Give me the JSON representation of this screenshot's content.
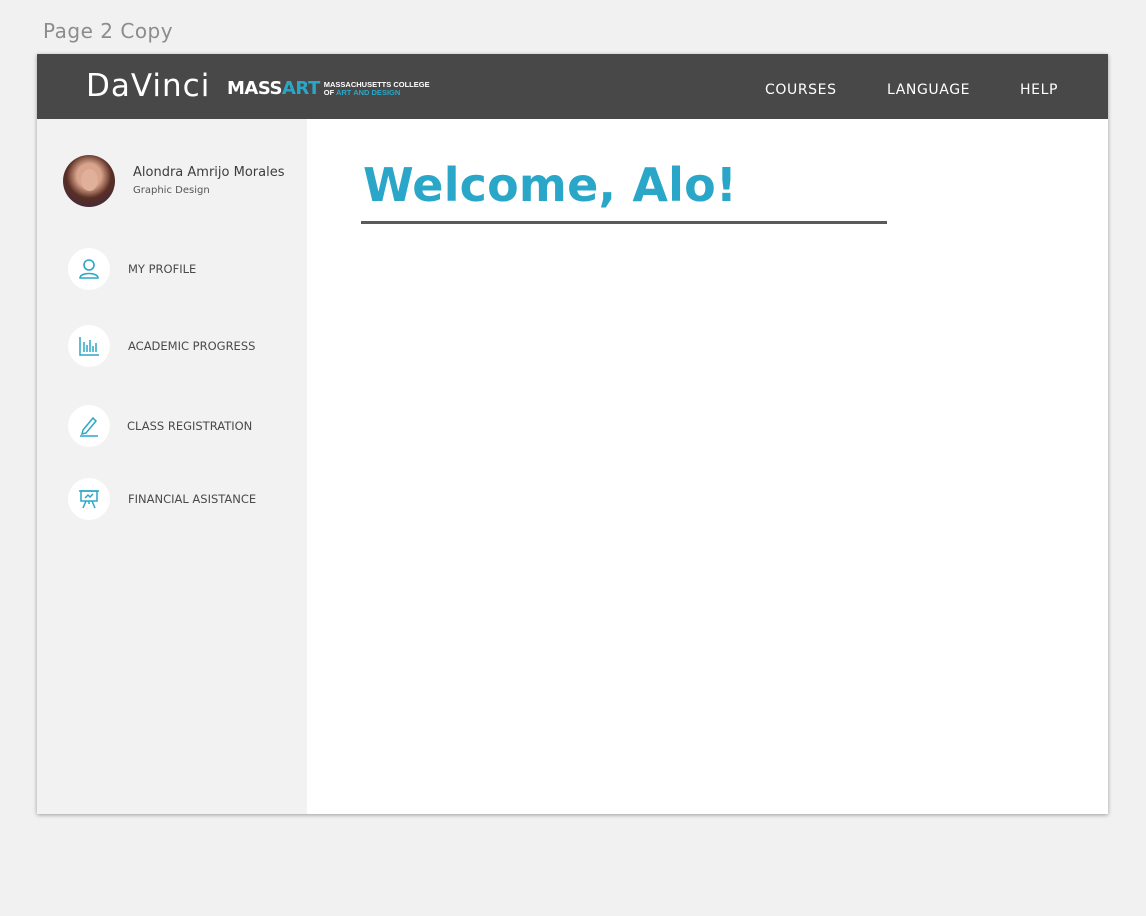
{
  "artboard_label": "Page 2 Copy",
  "header": {
    "brand": "DaVinci",
    "logo": {
      "mass": "MASS",
      "art": "ART",
      "line1": "MASSACHUSETTS COLLEGE",
      "line2_prefix": "OF ",
      "line2_highlight": "ART AND DESIGN"
    },
    "nav": [
      {
        "label": "COURSES"
      },
      {
        "label": "LANGUAGE"
      },
      {
        "label": "HELP"
      }
    ]
  },
  "sidebar": {
    "user": {
      "name": "Alondra Amrijo Morales",
      "major": "Graphic Design"
    },
    "items": [
      {
        "label": "MY PROFILE",
        "icon": "user-icon"
      },
      {
        "label": "ACADEMIC PROGRESS",
        "icon": "bar-chart-icon"
      },
      {
        "label": "CLASS REGISTRATION",
        "icon": "pencil-icon"
      },
      {
        "label": "FINANCIAL ASISTANCE",
        "icon": "presentation-board-icon"
      }
    ]
  },
  "main": {
    "welcome": "Welcome, Alo!"
  },
  "colors": {
    "accent": "#2aa7c8",
    "header_bg": "#484848",
    "sidebar_bg": "#f2f2f2"
  }
}
